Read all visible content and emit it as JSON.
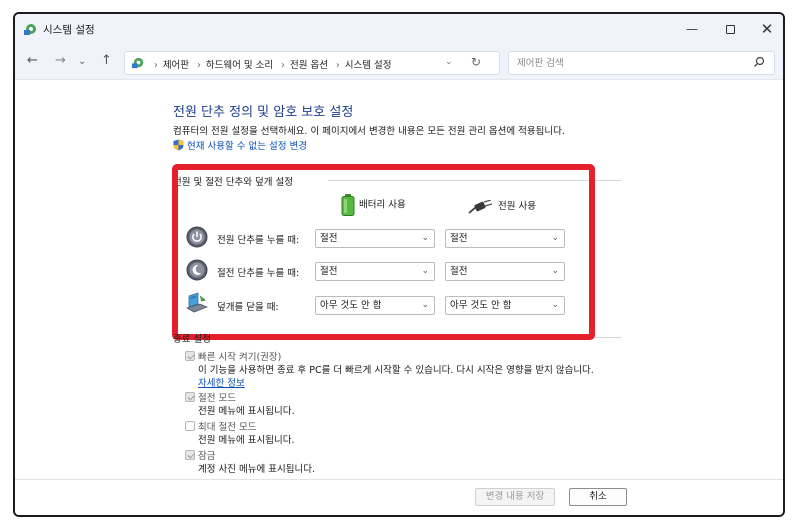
{
  "window": {
    "title": "시스템 설정",
    "controls": {
      "minimize": "—",
      "close": "✕"
    }
  },
  "nav": {
    "back": "←",
    "forward": "→",
    "recent": "⌄",
    "up": "↑",
    "breadcrumb_sep": "›",
    "breadcrumbs": [
      "제어판",
      "하드웨어 및 소리",
      "전원 옵션",
      "시스템 설정"
    ],
    "dropdown": "⌄",
    "refresh": "↻",
    "search_placeholder": "제어판 검색"
  },
  "main": {
    "title": "전원 단추 정의 및 암호 보호 설정",
    "description": "컴퓨터의 전원 설정을 선택하세요. 이 페이지에서 변경한 내용은 모든 전원 관리 옵션에 적용됩니다.",
    "unavailable_link": "현재 사용할 수 없는 설정 변경"
  },
  "power_section": {
    "header": "전원 및 절전 단추와 덮개 설정",
    "col_battery": "배터리 사용",
    "col_plugged": "전원 사용",
    "rows": [
      {
        "label": "전원 단추를 누를 때:",
        "icon": "power-button-icon",
        "battery": "절전",
        "plugged": "절전"
      },
      {
        "label": "절전 단추를 누를 때:",
        "icon": "sleep-button-icon",
        "battery": "절전",
        "plugged": "절전"
      },
      {
        "label": "덮개를 닫을 때:",
        "icon": "laptop-lid-icon",
        "battery": "아무 것도 안 함",
        "plugged": "아무 것도 안 함"
      }
    ],
    "chevron": "⌄"
  },
  "shutdown_section": {
    "header": "종료 설정",
    "options": [
      {
        "label": "빠른 시작 켜기(권장)",
        "checked": true,
        "description": "이 기능을 사용하면 종료 후 PC를 더 빠르게 시작할 수 있습니다. 다시 시작은 영향을 받지 않습니다.",
        "link": "자세한 정보"
      },
      {
        "label": "절전 모드",
        "checked": true,
        "description": "전원 메뉴에 표시됩니다."
      },
      {
        "label": "최대 절전 모드",
        "checked": false,
        "description": "전원 메뉴에 표시됩니다."
      },
      {
        "label": "잠금",
        "checked": true,
        "description": "계정 사진 메뉴에 표시됩니다."
      }
    ]
  },
  "footer": {
    "save_label": "변경 내용 저장",
    "cancel_label": "취소"
  },
  "colors": {
    "highlight_box": "#e4202e",
    "title_blue": "#1d3d8f",
    "link_blue": "#0b4fb5"
  }
}
